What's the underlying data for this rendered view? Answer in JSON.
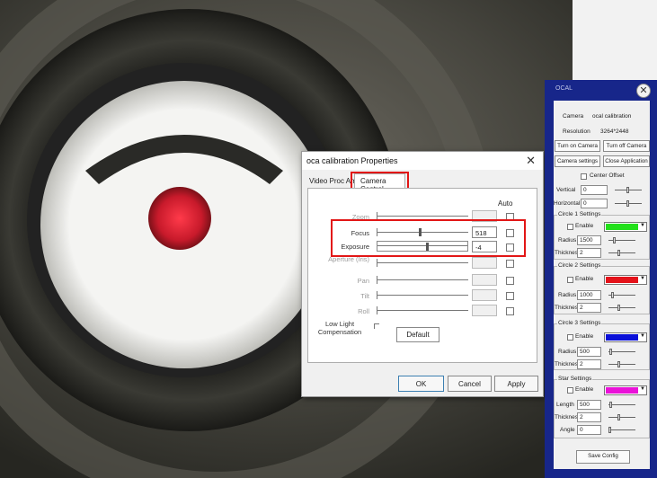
{
  "dialog": {
    "title": "oca calibration Properties",
    "close": "✕",
    "tabs": [
      "Video Proc Amp",
      "Camera Control"
    ],
    "active_tab": "Camera Control",
    "auto_header": "Auto",
    "properties": [
      {
        "label": "Zoom",
        "value": "",
        "enabled": false,
        "slider": 0.0
      },
      {
        "label": "Focus",
        "value": "518",
        "enabled": true,
        "slider": 0.47
      },
      {
        "label": "Exposure",
        "value": "-4",
        "enabled": true,
        "slider": 0.55
      },
      {
        "label": "Aperture (Iris)",
        "value": "",
        "enabled": false,
        "slider": 0.0
      },
      {
        "label": "Pan",
        "value": "",
        "enabled": false,
        "slider": 0.0
      },
      {
        "label": "Tilt",
        "value": "",
        "enabled": false,
        "slider": 0.0
      },
      {
        "label": "Roll",
        "value": "",
        "enabled": false,
        "slider": 0.0
      }
    ],
    "low_light_label": "Low Light Compensation",
    "default_btn": "Default",
    "ok_btn": "OK",
    "cancel_btn": "Cancel",
    "apply_btn": "Apply"
  },
  "ocal": {
    "title": "OCAL",
    "close": "✕",
    "camera_label": "Camera",
    "camera_value": "ocal calibration",
    "resolution_label": "Resolution",
    "resolution_value": "3264*2448",
    "turn_on": "Turn on Camera",
    "turn_off": "Turn off Camera",
    "camera_settings": "Camera settings",
    "close_app": "Close Application",
    "center_offset": "Center Offset",
    "vertical_label": "Vertical",
    "vertical_value": "0",
    "horizontal_label": "Horizontal",
    "horizontal_value": "0",
    "circle1": {
      "title": "Circle 1 Settings",
      "enable": "Enable",
      "color": "#22e01a",
      "radius_label": "Radius",
      "radius": "1500",
      "thickness_label": "Thickness",
      "thickness": "2"
    },
    "circle2": {
      "title": "Circle 2 Settings",
      "enable": "Enable",
      "color": "#e4121a",
      "radius_label": "Radius",
      "radius": "1000",
      "thickness_label": "Thickness",
      "thickness": "2"
    },
    "circle3": {
      "title": "Circle 3 Settings",
      "enable": "Enable",
      "color": "#0a10d8",
      "radius_label": "Radius",
      "radius": "500",
      "thickness_label": "Thickness",
      "thickness": "2"
    },
    "star": {
      "title": "Star Settings",
      "enable": "Enable",
      "color": "#ea12d8",
      "length_label": "Length",
      "length": "500",
      "thickness_label": "Thickness",
      "thickness": "2",
      "angle_label": "Angle",
      "angle": "0"
    },
    "save_config": "Save Config"
  }
}
